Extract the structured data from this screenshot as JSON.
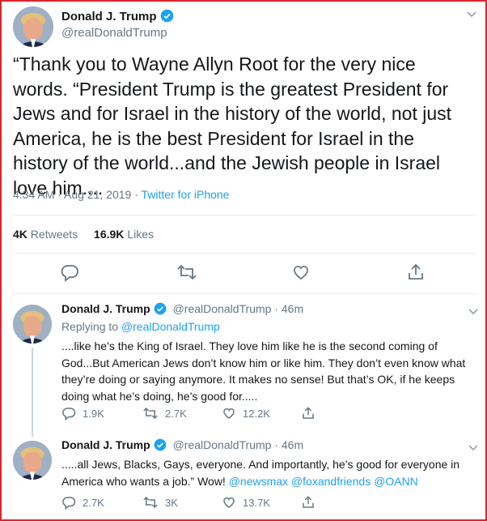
{
  "main_tweet": {
    "name": "Donald J. Trump",
    "handle": "@realDonaldTrump",
    "text": "“Thank you to Wayne Allyn Root for the very nice words. “President Trump is the greatest President for Jews and for Israel in the history of the world, not just America, he is the best President for Israel in the history of the world...and the Jewish people in Israel love him....",
    "time": "4:34 AM · Aug 21, 2019 · ",
    "source": "Twitter for iPhone",
    "retweets_count": "4K",
    "retweets_label": " Retweets",
    "likes_count": "16.9K",
    "likes_label": " Likes"
  },
  "reply1": {
    "name": "Donald J. Trump",
    "handle": "@realDonaldTrump · 46m",
    "replying_prefix": "Replying to ",
    "replying_handle": "@realDonaldTrump",
    "text": "....like he’s the King of Israel. They love him like he is the second coming of God...But American Jews don’t know him or like him. They don’t even know what they’re doing or saying anymore. It makes no sense! But that’s OK, if he keeps doing what he’s doing, he’s good for.....",
    "replies": "1.9K",
    "retweets": "2.7K",
    "likes": "12.2K"
  },
  "reply2": {
    "name": "Donald J. Trump",
    "handle": "@realDonaldTrump · 46m",
    "text_main": ".....all Jews, Blacks, Gays, everyone. And importantly, he’s good for everyone in America who wants a job.” Wow! ",
    "mention1": "@newsmax",
    "mention2": "@foxandfriends",
    "mention3": "@OANN",
    "replies": "2.7K",
    "retweets": "3K",
    "likes": "13.7K"
  },
  "icons": [
    "verified-badge-icon",
    "chevron-down-icon",
    "reply-icon",
    "retweet-icon",
    "like-icon",
    "share-icon"
  ],
  "colors": {
    "accent": "#1da1f2",
    "secondary_text": "#657786",
    "border": "#d8262c"
  }
}
